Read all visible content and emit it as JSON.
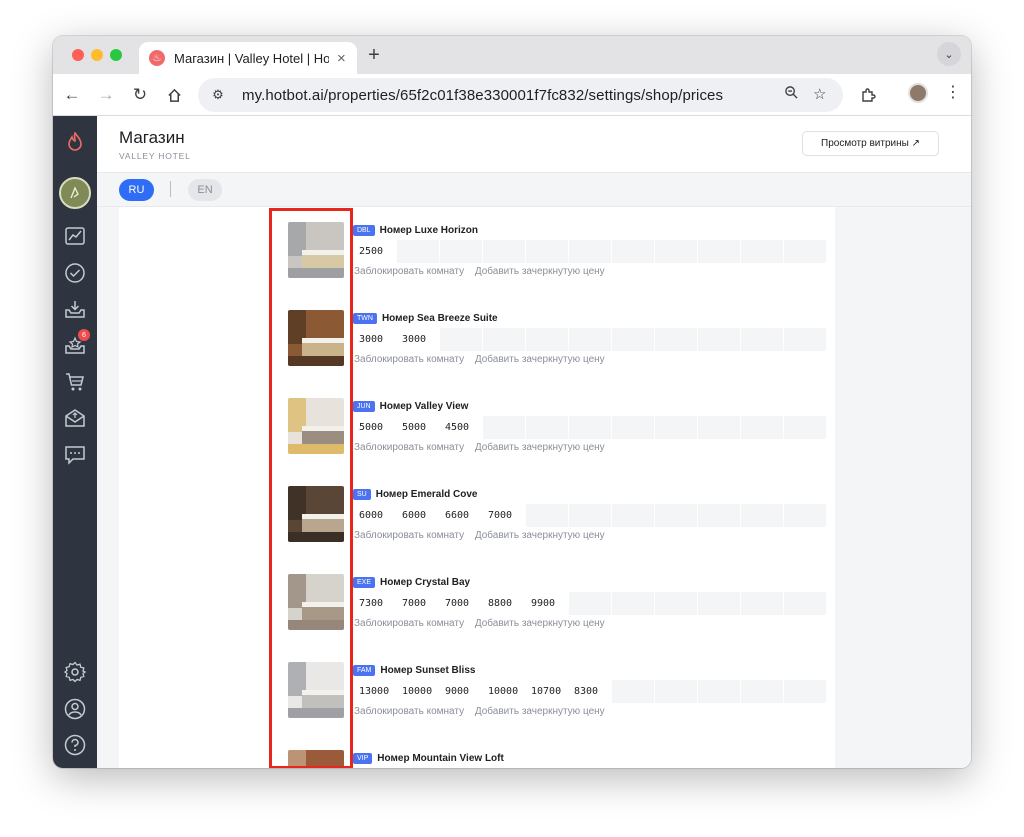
{
  "browser": {
    "tab_title": "Магазин | Valley Hotel | Hotbot",
    "url": "my.hotbot.ai/properties/65f2c01f38e330001f7fc832/settings/shop/prices"
  },
  "sidebar": {
    "notification_count": "6"
  },
  "header": {
    "title": "Магазин",
    "hotel": "VALLEY HOTEL",
    "preview_button": "Просмотр витрины ↗"
  },
  "languages": {
    "active": "RU",
    "inactive": "EN"
  },
  "actions": {
    "block_room": "Заблокировать комнату",
    "add_strike_price": "Добавить зачеркнутую цену"
  },
  "rooms": [
    {
      "badge": "DBL",
      "name": "Номер Luxe Horizon",
      "prices": [
        "2500"
      ]
    },
    {
      "badge": "TWN",
      "name": "Номер Sea Breeze Suite",
      "prices": [
        "3000",
        "3000"
      ]
    },
    {
      "badge": "JUN",
      "name": "Номер Valley View",
      "prices": [
        "5000",
        "5000",
        "4500"
      ]
    },
    {
      "badge": "SU",
      "name": "Номер Emerald Cove",
      "prices": [
        "6000",
        "6000",
        "6600",
        "7000"
      ]
    },
    {
      "badge": "EXE",
      "name": "Номер Crystal Bay",
      "prices": [
        "7300",
        "7000",
        "7000",
        "8800",
        "9900"
      ]
    },
    {
      "badge": "FAM",
      "name": "Номер Sunset Bliss",
      "prices": [
        "13000",
        "10000",
        "9000",
        "10000",
        "10700",
        "8300"
      ]
    },
    {
      "badge": "VIP",
      "name": "Номер Mountain View Loft",
      "prices": []
    }
  ],
  "colors": {
    "accent": "#2f6df6",
    "sidebar": "#2f3540",
    "badge": "#4b72f0",
    "highlight": "#e8261b"
  }
}
